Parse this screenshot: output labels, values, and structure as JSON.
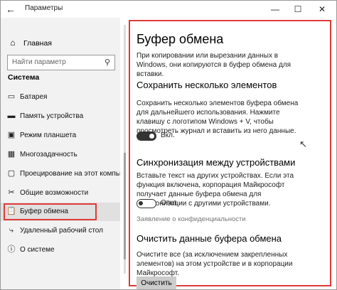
{
  "titlebar": {
    "title": "Параметры",
    "back_icon": "←",
    "minimize_icon": "—",
    "maximize_icon": "☐",
    "close_icon": "✕"
  },
  "sidebar": {
    "home_label": "Главная",
    "search_placeholder": "Найти параметр",
    "section_label": "Система",
    "items": [
      {
        "label": "Батарея",
        "icon": "▭"
      },
      {
        "label": "Память устройства",
        "icon": "▬"
      },
      {
        "label": "Режим планшета",
        "icon": "▣"
      },
      {
        "label": "Многозадачность",
        "icon": "▦"
      },
      {
        "label": "Проецирование на этот компьютер",
        "icon": "▢"
      },
      {
        "label": "Общие возможности",
        "icon": "✂"
      },
      {
        "label": "Буфер обмена",
        "icon": "📋"
      },
      {
        "label": "Удаленный рабочий стол",
        "icon": "⤷"
      },
      {
        "label": "О системе",
        "icon": "ⓘ"
      }
    ]
  },
  "main": {
    "title": "Буфер обмена",
    "intro": "При копировании или вырезании данных в Windows, они копируются в буфер обмена для вставки.",
    "history": {
      "heading": "Сохранить несколько элементов",
      "text": "Сохранить несколько элементов буфера обмена для дальнейшего использования. Нажмите клавишу с логотипом Windows + V, чтобы просмотреть журнал и вставить из него данные.",
      "toggle_label": "Вкл.",
      "toggle_on": true
    },
    "sync": {
      "heading": "Синхронизация между устройствами",
      "text": "Вставьте текст на других устройствах. Если эта функция включена, корпорация Майкрософт получает данные буфера обмена для синхронизации с другими устройствами.",
      "toggle_label": "Откл.",
      "toggle_on": false,
      "privacy_link": "Заявление о конфиденциальности"
    },
    "clear": {
      "heading": "Очистить данные буфера обмена",
      "text": "Очистите все (за исключением закрепленных элементов) на этом устройстве и в корпорации Майкрософт.",
      "button_label": "Очистить"
    }
  },
  "colors": {
    "highlight": "#e03a3a",
    "sidebar_bg": "#f2f2f2"
  }
}
